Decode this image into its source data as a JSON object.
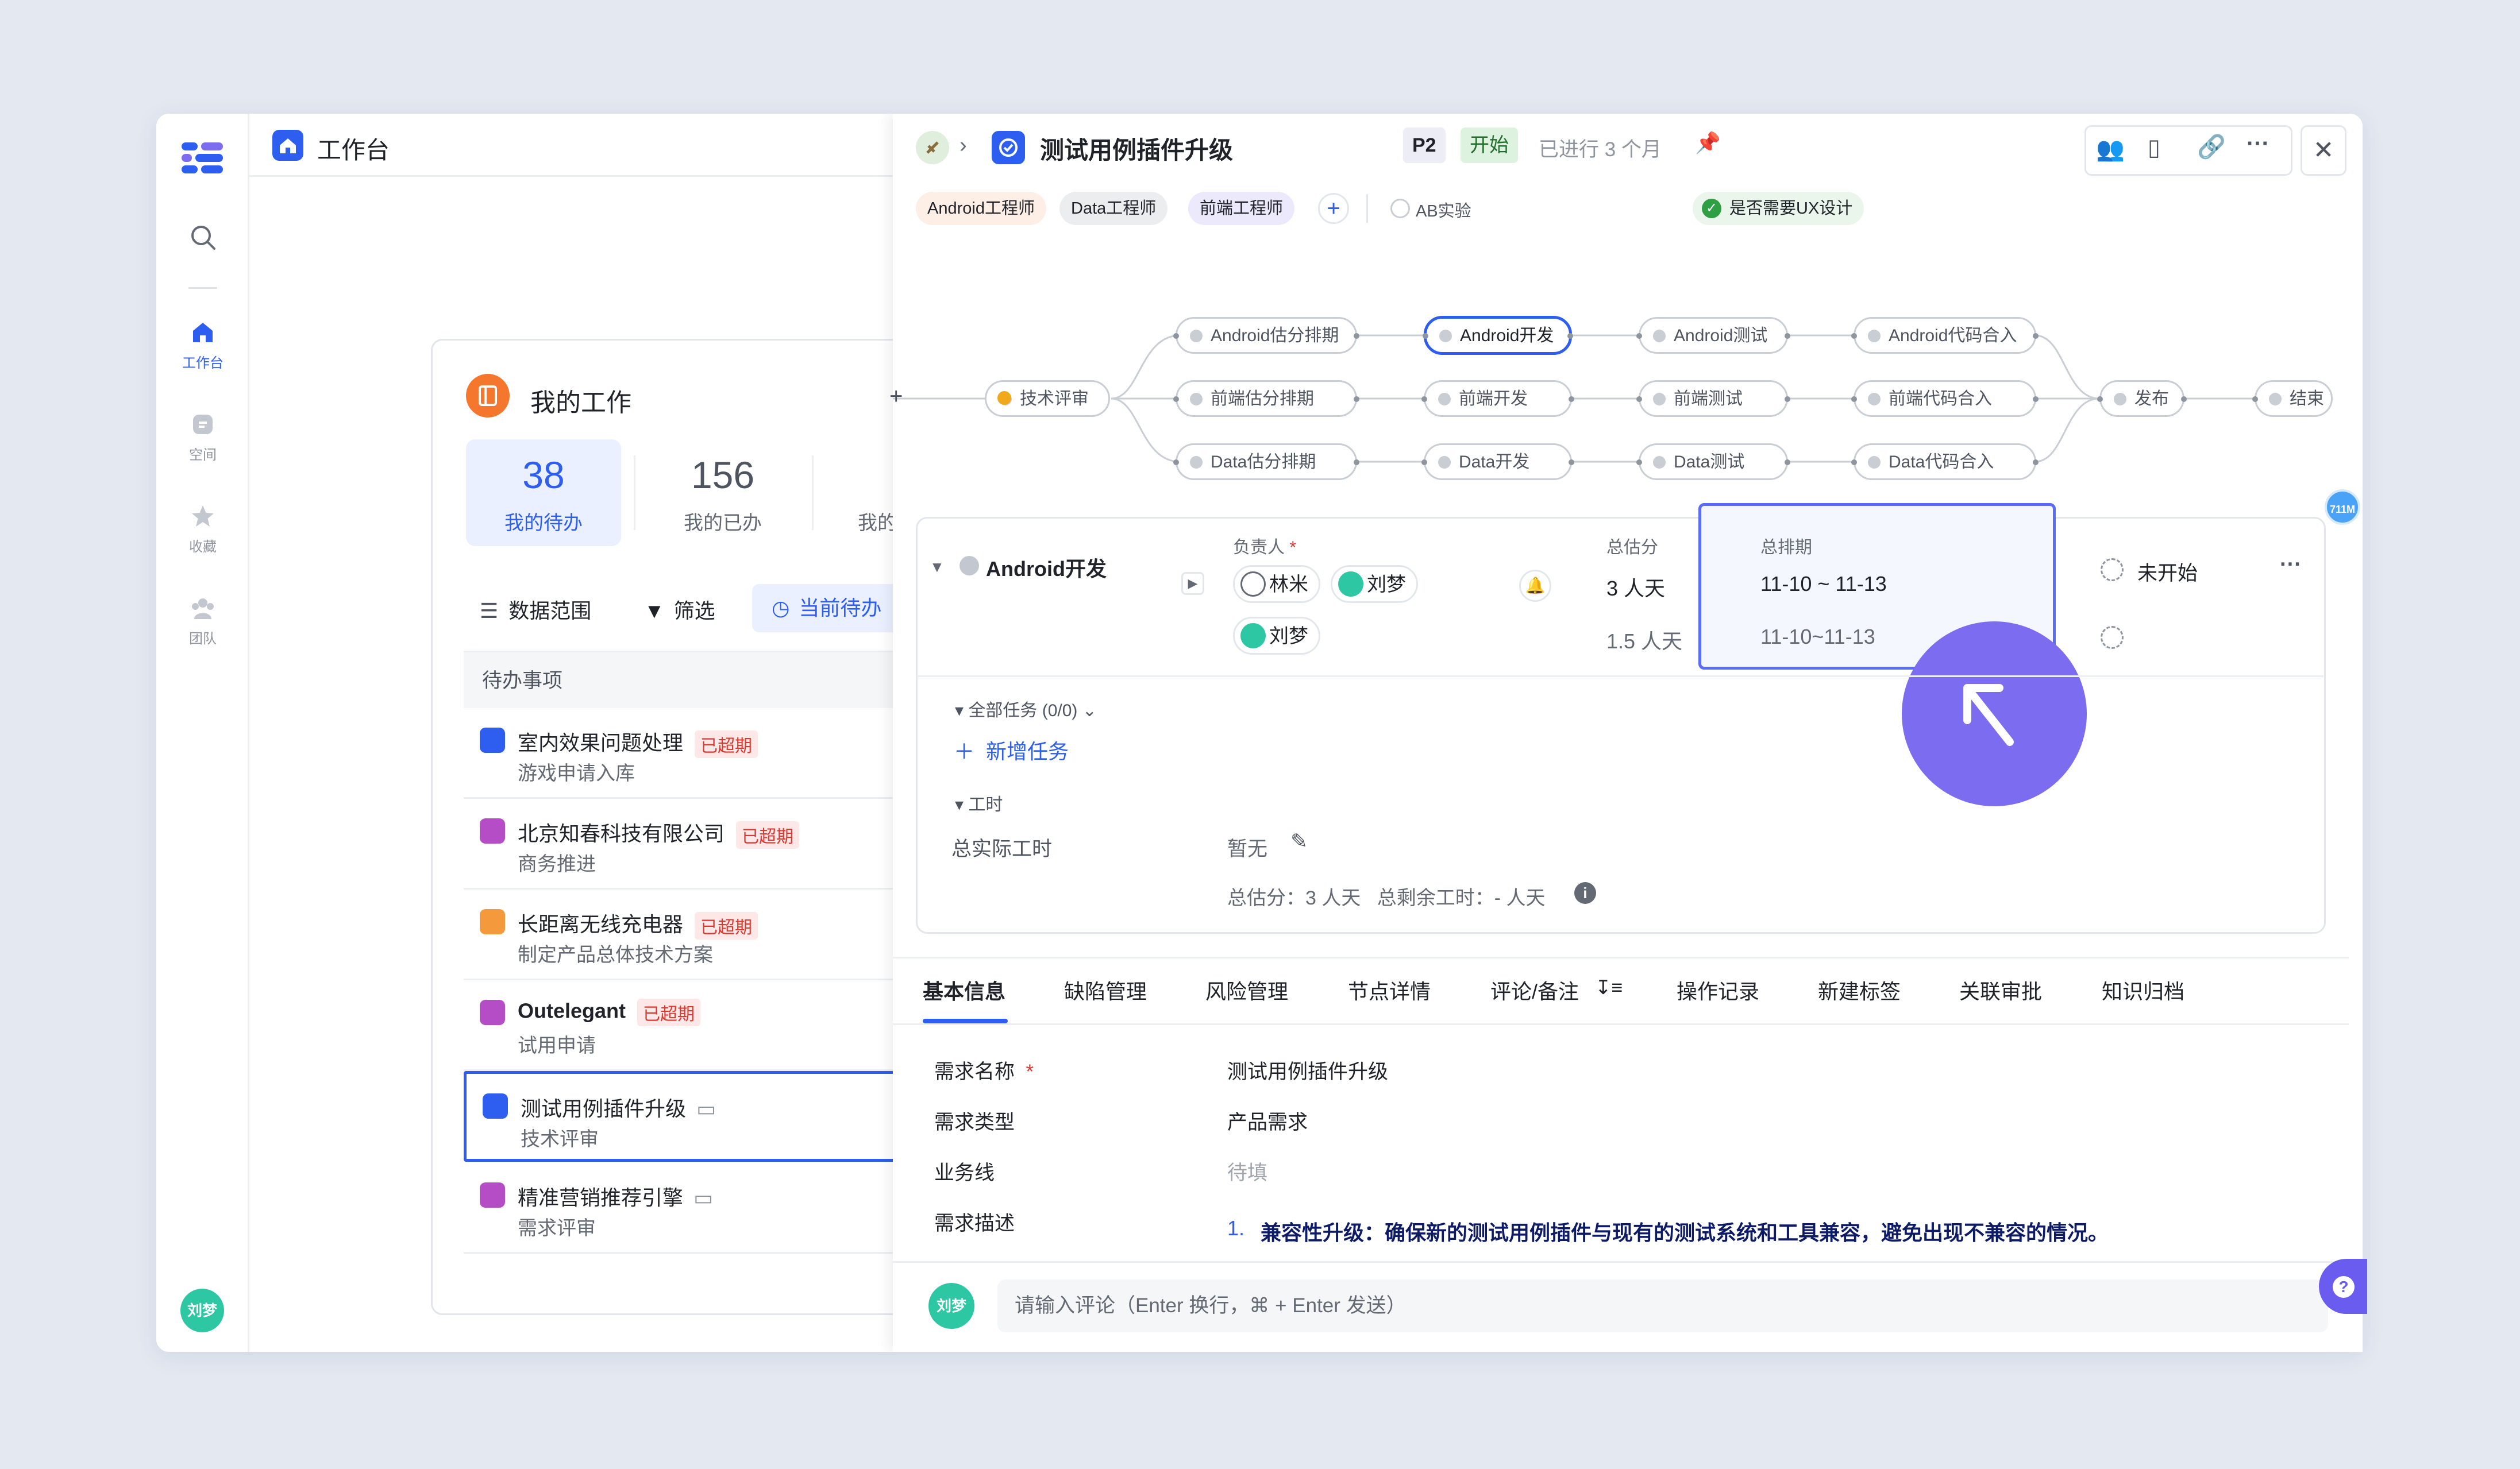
{
  "nav": {
    "items": [
      {
        "label": "工作台"
      },
      {
        "label": "空间"
      },
      {
        "label": "收藏"
      },
      {
        "label": "团队"
      }
    ],
    "user_avatar": "刘梦"
  },
  "workbench": {
    "title": "工作台",
    "card_title": "我的工作",
    "stats": [
      {
        "value": "38",
        "label": "我的待办"
      },
      {
        "value": "156",
        "label": "我的已办"
      },
      {
        "label": "我的"
      }
    ],
    "toolbar": {
      "range": "数据范围",
      "filter": "筛选",
      "current": "当前待办"
    },
    "list_header": "待办事项",
    "overdue_label": "已超期",
    "items": [
      {
        "title": "室内效果问题处理",
        "sub": "游戏申请入库",
        "overdue": true,
        "color": "#2d5ef0"
      },
      {
        "title": "北京知春科技有限公司",
        "sub": "商务推进",
        "overdue": true,
        "color": "#b54dc7"
      },
      {
        "title": "长距离无线充电器",
        "sub": "制定产品总体技术方案",
        "overdue": true,
        "color": "#f59a3c"
      },
      {
        "title": "Outelegant",
        "sub": "试用申请",
        "overdue": true,
        "color": "#b54dc7"
      },
      {
        "title": "测试用例插件升级",
        "sub": "技术评审",
        "overdue": false,
        "color": "#2d5ef0"
      },
      {
        "title": "精准营销推荐引擎",
        "sub": "需求评审",
        "overdue": false,
        "color": "#b54dc7"
      }
    ]
  },
  "detail": {
    "title": "测试用例插件升级",
    "priority": "P2",
    "status": "开始",
    "elapsed": "已进行 3 个月",
    "roles": [
      "Android工程师",
      "Data工程师",
      "前端工程师"
    ],
    "ab_test": "AB实验",
    "ux_design": "是否需要UX设计",
    "flow": {
      "start": "技术评审",
      "rows": [
        [
          "Android估分排期",
          "Android开发",
          "Android测试",
          "Android代码合入"
        ],
        [
          "前端估分排期",
          "前端开发",
          "前端测试",
          "前端代码合入"
        ],
        [
          "Data估分排期",
          "Data开发",
          "Data测试",
          "Data代码合入"
        ]
      ],
      "publish": "发布",
      "end": "结束"
    },
    "badge_711m": "711M",
    "node_detail": {
      "name": "Android开发",
      "owner_label": "负责人",
      "estimate_label": "总估分",
      "schedule_label": "总排期",
      "owners": [
        "林米",
        "刘梦"
      ],
      "sub_owner": "刘梦",
      "estimate": "3 人天",
      "sub_estimate": "1.5 人天",
      "schedule": "11-10 ~ 11-13",
      "sub_schedule": "11-10~11-13",
      "state": "未开始",
      "all_tasks": "全部任务 (0/0)",
      "add_task": "新增任务",
      "worktime_label": "工时",
      "actual_label": "总实际工时",
      "actual_value": "暂无",
      "summary": "总估分：3 人天   总剩余工时：- 人天"
    },
    "tabs": [
      "基本信息",
      "缺陷管理",
      "风险管理",
      "节点详情",
      "评论/备注",
      "操作记录",
      "新建标签",
      "关联审批",
      "知识归档"
    ],
    "fields": [
      {
        "label": "需求名称",
        "value": "测试用例插件升级",
        "required": true
      },
      {
        "label": "需求类型",
        "value": "产品需求"
      },
      {
        "label": "业务线",
        "value": "待填",
        "muted": true
      },
      {
        "label": "需求描述",
        "value": "兼容性升级：确保新的测试用例插件与现有的测试系统和工具兼容，避免出现不兼容的情况。"
      }
    ],
    "comment_avatar": "刘梦",
    "comment_placeholder": "请输入评论（Enter 换行，⌘ + Enter 发送）"
  },
  "colors": {
    "accent": "#2d5ef0",
    "cursor_circle": "#7b6cf0",
    "overdue": "#d83931"
  }
}
